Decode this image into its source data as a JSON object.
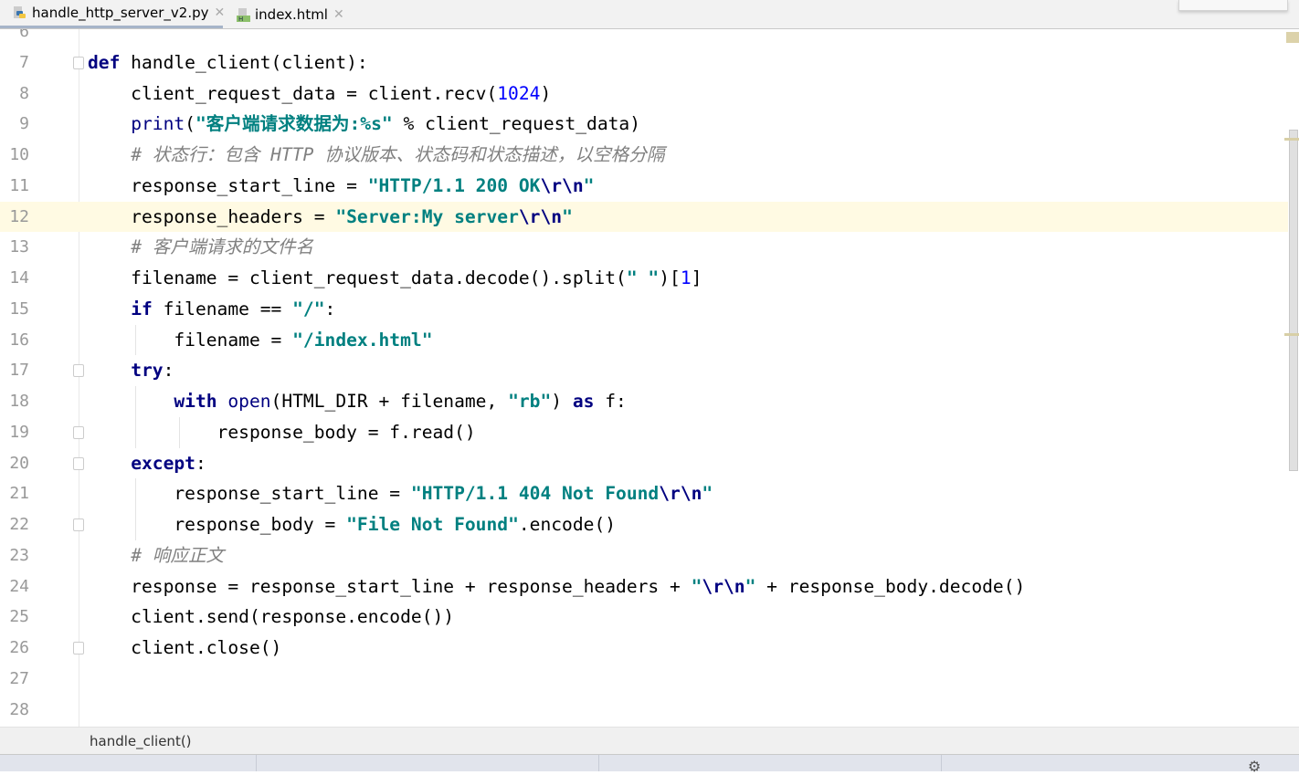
{
  "tabs": [
    {
      "label": "handle_http_server_v2.py",
      "icon": "python-file-icon",
      "active": true
    },
    {
      "label": "index.html",
      "icon": "html-file-icon",
      "active": false
    }
  ],
  "editor": {
    "highlighted_line": 12,
    "lines": [
      {
        "n": "6",
        "tokens": []
      },
      {
        "n": "7",
        "fold": true,
        "tokens": [
          [
            "kw",
            "def"
          ],
          [
            "plain",
            " handle_client(client):"
          ]
        ]
      },
      {
        "n": "8",
        "tokens": [
          [
            "plain",
            "    client_request_data = client.recv("
          ],
          [
            "num",
            "1024"
          ],
          [
            "plain",
            ")"
          ]
        ]
      },
      {
        "n": "9",
        "tokens": [
          [
            "plain",
            "    "
          ],
          [
            "bi",
            "print"
          ],
          [
            "plain",
            "("
          ],
          [
            "str",
            "\"客户端请求数据为:%s\""
          ],
          [
            "plain",
            " % client_request_data)"
          ]
        ]
      },
      {
        "n": "10",
        "tokens": [
          [
            "plain",
            "    "
          ],
          [
            "cm",
            "# 状态行：包含 HTTP 协议版本、状态码和状态描述，以空格分隔"
          ]
        ]
      },
      {
        "n": "11",
        "tokens": [
          [
            "plain",
            "    response_start_line = "
          ],
          [
            "str",
            "\"HTTP/1.1 200 OK"
          ],
          [
            "esc",
            "\\r\\n"
          ],
          [
            "str",
            "\""
          ]
        ]
      },
      {
        "n": "12",
        "tokens": [
          [
            "plain",
            "    response_headers = "
          ],
          [
            "str",
            "\"Server:My server"
          ],
          [
            "esc",
            "\\r\\n"
          ],
          [
            "str",
            "\""
          ]
        ]
      },
      {
        "n": "13",
        "tokens": [
          [
            "plain",
            "    "
          ],
          [
            "cm",
            "# 客户端请求的文件名"
          ]
        ]
      },
      {
        "n": "14",
        "tokens": [
          [
            "plain",
            "    filename = client_request_data.decode().split("
          ],
          [
            "str",
            "\" \""
          ],
          [
            "plain",
            ")["
          ],
          [
            "num",
            "1"
          ],
          [
            "plain",
            "]"
          ]
        ]
      },
      {
        "n": "15",
        "tokens": [
          [
            "plain",
            "    "
          ],
          [
            "kw",
            "if"
          ],
          [
            "plain",
            " filename == "
          ],
          [
            "str",
            "\"/\""
          ],
          [
            "plain",
            ":"
          ]
        ]
      },
      {
        "n": "16",
        "guides": [
          1
        ],
        "tokens": [
          [
            "plain",
            "        filename = "
          ],
          [
            "str",
            "\"/index.html\""
          ]
        ]
      },
      {
        "n": "17",
        "fold": true,
        "tokens": [
          [
            "plain",
            "    "
          ],
          [
            "kw",
            "try"
          ],
          [
            "plain",
            ":"
          ]
        ]
      },
      {
        "n": "18",
        "guides": [
          1
        ],
        "tokens": [
          [
            "plain",
            "        "
          ],
          [
            "kw",
            "with"
          ],
          [
            "plain",
            " "
          ],
          [
            "bi",
            "open"
          ],
          [
            "plain",
            "(HTML_DIR + filename, "
          ],
          [
            "str",
            "\"rb\""
          ],
          [
            "plain",
            ") "
          ],
          [
            "kw",
            "as"
          ],
          [
            "plain",
            " f:"
          ]
        ]
      },
      {
        "n": "19",
        "fold": true,
        "guides": [
          1,
          2
        ],
        "tokens": [
          [
            "plain",
            "            response_body = f.read()"
          ]
        ]
      },
      {
        "n": "20",
        "fold": true,
        "tokens": [
          [
            "plain",
            "    "
          ],
          [
            "kw",
            "except"
          ],
          [
            "plain",
            ":"
          ]
        ]
      },
      {
        "n": "21",
        "guides": [
          1
        ],
        "tokens": [
          [
            "plain",
            "        response_start_line = "
          ],
          [
            "str",
            "\"HTTP/1.1 404 Not Found"
          ],
          [
            "esc",
            "\\r\\n"
          ],
          [
            "str",
            "\""
          ]
        ]
      },
      {
        "n": "22",
        "fold": true,
        "guides": [
          1
        ],
        "tokens": [
          [
            "plain",
            "        response_body = "
          ],
          [
            "str",
            "\"File Not Found\""
          ],
          [
            "plain",
            ".encode()"
          ]
        ]
      },
      {
        "n": "23",
        "tokens": [
          [
            "plain",
            "    "
          ],
          [
            "cm",
            "# 响应正文"
          ]
        ]
      },
      {
        "n": "24",
        "tokens": [
          [
            "plain",
            "    response = response_start_line + response_headers + "
          ],
          [
            "str",
            "\""
          ],
          [
            "esc",
            "\\r\\n"
          ],
          [
            "str",
            "\""
          ],
          [
            "plain",
            " + response_body.decode()"
          ]
        ]
      },
      {
        "n": "25",
        "tokens": [
          [
            "plain",
            "    client.send(response.encode())"
          ]
        ]
      },
      {
        "n": "26",
        "fold": true,
        "tokens": [
          [
            "plain",
            "    client.close()"
          ]
        ]
      },
      {
        "n": "27",
        "tokens": []
      },
      {
        "n": "28",
        "tokens": []
      }
    ]
  },
  "breadcrumb": {
    "label": "handle_client()"
  },
  "status": {
    "icon": "gear-icon"
  }
}
